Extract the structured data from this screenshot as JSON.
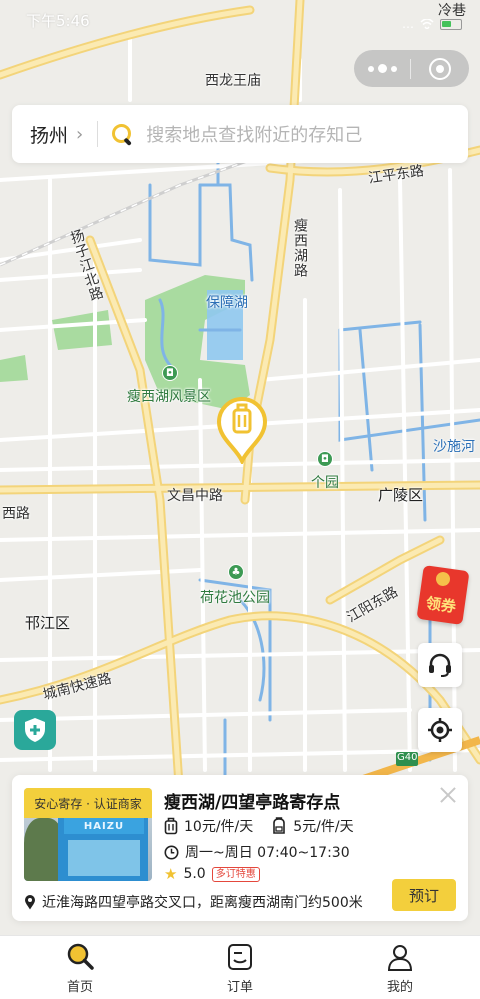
{
  "status_bar": {
    "time": "下午5:46",
    "carrier": "冷巷",
    "signal": "…"
  },
  "map": {
    "labels": {
      "xilong_temple": "西龙王庙",
      "jiangping_east_road": "江平东路",
      "shouxihu_road": "瘦西湖路",
      "yangzijiang_north_road": "扬子江北路",
      "baozhang_lake": "保障湖",
      "shouxihu_scenic": "瘦西湖风景区",
      "shashi_river": "沙施河",
      "ge_garden": "个园",
      "wenchang_middle_road": "文昌中路",
      "guangling_district": "广陵区",
      "west_road": "西路",
      "hehuachi_park": "荷花池公园",
      "jiangyang_east_road": "江阳东路",
      "hanjiang_district": "邗江区",
      "chengnan_expressway": "城南快速路",
      "g40": "G40"
    }
  },
  "search": {
    "city": "扬州",
    "placeholder": "搜索地点查找附近的存知己"
  },
  "coupon": {
    "label": "领券"
  },
  "card": {
    "tag": "安心寄存 · 认证商家",
    "photo_sign": "HAIZU",
    "title": "瘦西湖/四望亭路寄存点",
    "price_luggage": "10元/件/天",
    "price_bag": "5元/件/天",
    "hours": "周一~周日 07:40~17:30",
    "rating": "5.0",
    "rating_badge": "多订特惠",
    "address": "近淮海路四望亭路交叉口，距离瘦西湖南门约500米",
    "book_label": "预订"
  },
  "tabs": [
    {
      "label": "首页",
      "icon": "search-icon",
      "active": true
    },
    {
      "label": "订单",
      "icon": "order-icon",
      "active": false
    },
    {
      "label": "我的",
      "icon": "profile-icon",
      "active": false
    }
  ],
  "colors": {
    "accent": "#f3cf3c",
    "shield": "#2aa89a",
    "coupon": "#e8372c",
    "water": "#7fb4e6",
    "park": "#a9dba0",
    "road_major": "#f8de8a"
  }
}
